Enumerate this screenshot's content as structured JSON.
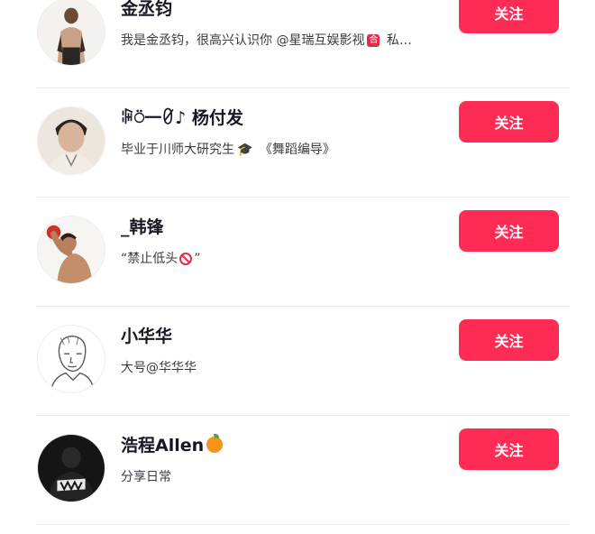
{
  "users": [
    {
      "name": "金丞钧",
      "bio": "我是金丞钧，很高兴认识你 @星瑞互娱影视",
      "bio_emoji": "合",
      "bio_suffix": " 私…",
      "follow_label": "关注",
      "avatar_icon": "person-photo"
    },
    {
      "name": "ꁶ⍥一ꀜ♪ 杨付发",
      "bio": "毕业于川师大研究生",
      "bio_emoji": "🎓",
      "bio_suffix": " 《舞蹈编导》",
      "follow_label": "关注",
      "avatar_icon": "person-photo"
    },
    {
      "name": "_韩锋",
      "bio": "“禁止低头",
      "bio_suffix": "”",
      "follow_label": "关注",
      "avatar_icon": "person-photo"
    },
    {
      "name": "小华华",
      "bio": "大号@华华华",
      "follow_label": "关注",
      "avatar_icon": "sketch-portrait"
    },
    {
      "name": "浩程Allen",
      "bio": "分享日常",
      "follow_label": "关注",
      "avatar_icon": "dark-photo"
    }
  ],
  "colors": {
    "follow_button": "#fe2c55",
    "divider": "#ececee",
    "name": "#161823",
    "bio": "#3a3a42"
  }
}
